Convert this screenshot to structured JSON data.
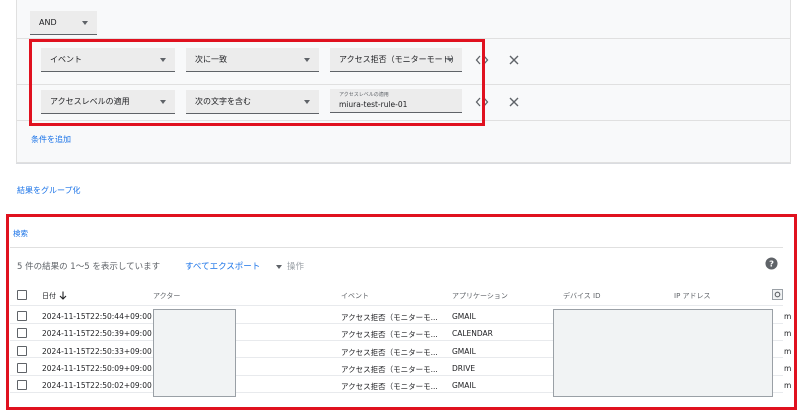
{
  "filter": {
    "operator": "AND",
    "conditions": [
      {
        "field": "イベント",
        "op": "次に一致",
        "value": "アクセス拒否（モニターモード）"
      },
      {
        "field": "アクセスレベルの適用",
        "op": "次の文字を含む",
        "value_label": "アクセスレベルの適用",
        "value": "miura-test-rule-01"
      }
    ],
    "add_condition": "条件を追加"
  },
  "group_results": "結果をグループ化",
  "search_label": "検索",
  "results": {
    "summary": "5 件の結果の 1〜5 を表示しています",
    "export_all": "すべてエクスポート",
    "actions": "操作",
    "columns": [
      "日付",
      "アクター",
      "イベント",
      "アプリケーション",
      "デバイス ID",
      "IP アドレス"
    ],
    "rows": [
      {
        "date": "2024-11-15T22:50:44+09:00",
        "event": "アクセス拒否（モニターモ...",
        "app": "GMAIL"
      },
      {
        "date": "2024-11-15T22:50:39+09:00",
        "event": "アクセス拒否（モニターモ...",
        "app": "CALENDAR"
      },
      {
        "date": "2024-11-15T22:50:33+09:00",
        "event": "アクセス拒否（モニターモ...",
        "app": "GMAIL"
      },
      {
        "date": "2024-11-15T22:50:09+09:00",
        "event": "アクセス拒否（モニターモ...",
        "app": "DRIVE"
      },
      {
        "date": "2024-11-15T22:50:02+09:00",
        "event": "アクセス拒否（モニターモ...",
        "app": "GMAIL"
      }
    ],
    "overflow_text": "m"
  },
  "colors": {
    "highlight": "#e0111f",
    "link": "#1a73e8",
    "field_bg": "#ececec"
  }
}
